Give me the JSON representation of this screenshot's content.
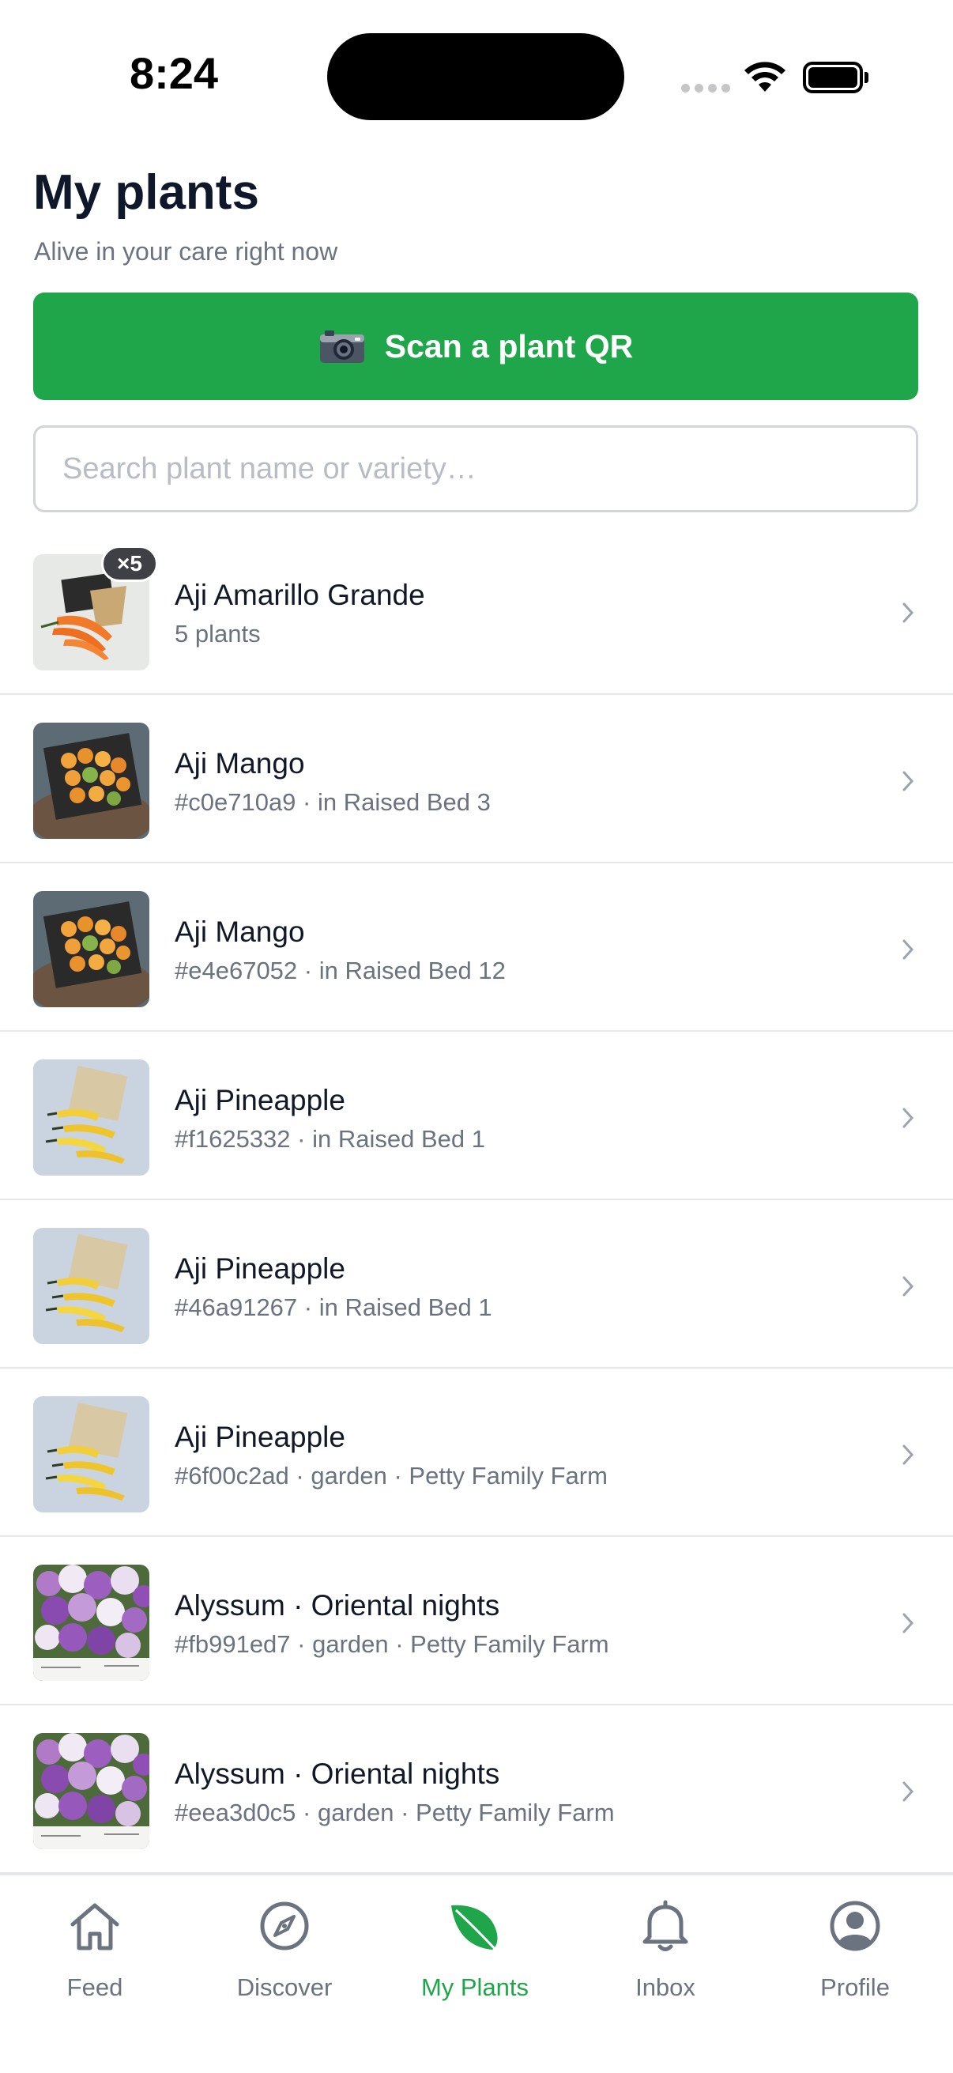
{
  "status_bar": {
    "time": "8:24"
  },
  "header": {
    "title": "My plants",
    "subtitle": "Alive in your care right now"
  },
  "scan_button": {
    "icon": "camera-icon",
    "label": "Scan a plant QR"
  },
  "search": {
    "placeholder": "Search plant name or variety…",
    "value": ""
  },
  "plants": [
    {
      "name": "Aji Amarillo Grande",
      "detail": "5 plants",
      "badge": "×5",
      "thumb": "orange-peppers"
    },
    {
      "name": "Aji Mango",
      "detail": "#c0e710a9 · in Raised Bed 3",
      "thumb": "mango-peppers"
    },
    {
      "name": "Aji Mango",
      "detail": "#e4e67052 · in Raised Bed 12",
      "thumb": "mango-peppers"
    },
    {
      "name": "Aji Pineapple",
      "detail": "#f1625332 · in Raised Bed 1",
      "thumb": "yellow-peppers"
    },
    {
      "name": "Aji Pineapple",
      "detail": "#46a91267 · in Raised Bed 1",
      "thumb": "yellow-peppers"
    },
    {
      "name": "Aji Pineapple",
      "detail": "#6f00c2ad · garden · Petty Family Farm",
      "thumb": "yellow-peppers"
    },
    {
      "name": "Alyssum · Oriental nights",
      "detail": "#fb991ed7 · garden · Petty Family Farm",
      "thumb": "purple-flowers"
    },
    {
      "name": "Alyssum · Oriental nights",
      "detail": "#eea3d0c5 · garden · Petty Family Farm",
      "thumb": "purple-flowers"
    }
  ],
  "tabs": [
    {
      "label": "Feed",
      "icon": "home-icon",
      "active": false
    },
    {
      "label": "Discover",
      "icon": "compass-icon",
      "active": false
    },
    {
      "label": "My Plants",
      "icon": "leaf-icon",
      "active": true
    },
    {
      "label": "Inbox",
      "icon": "bell-icon",
      "active": false
    },
    {
      "label": "Profile",
      "icon": "user-circle-icon",
      "active": false
    }
  ],
  "colors": {
    "accent": "#1fa64a",
    "text": "#111827",
    "muted": "#6b7280"
  }
}
